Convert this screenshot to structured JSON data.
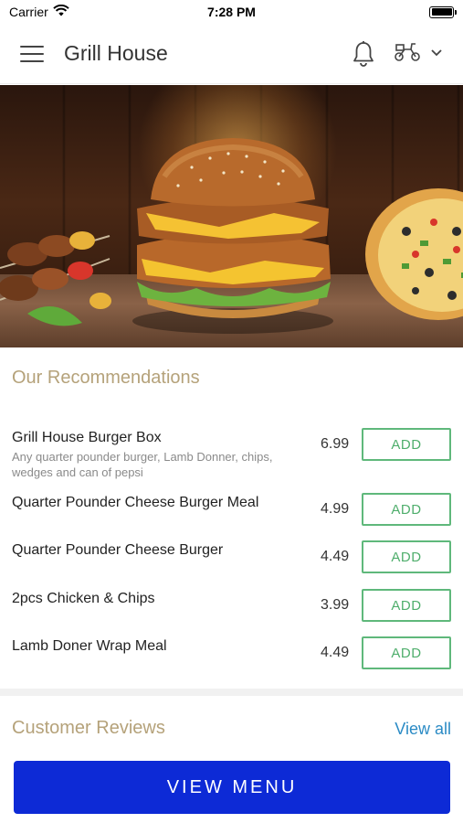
{
  "status_bar": {
    "carrier": "Carrier",
    "time": "7:28 PM",
    "icons": [
      "wifi-icon",
      "battery-icon"
    ]
  },
  "header": {
    "title": "Grill House",
    "icons": [
      "hamburger-menu-icon",
      "bell-icon",
      "scooter-delivery-icon",
      "chevron-down-icon"
    ]
  },
  "hero": {
    "description_icon": "food-banner-image"
  },
  "recommendations": {
    "title": "Our Recommendations",
    "items": [
      {
        "name": "Grill House Burger Box",
        "description": "Any quarter pounder burger, Lamb Donner, chips, wedges and can of pepsi",
        "price": "6.99",
        "button": "ADD"
      },
      {
        "name": "Quarter Pounder Cheese Burger Meal",
        "description": "",
        "price": "4.99",
        "button": "ADD"
      },
      {
        "name": "Quarter Pounder Cheese Burger",
        "description": "",
        "price": "4.49",
        "button": "ADD"
      },
      {
        "name": "2pcs Chicken & Chips",
        "description": "",
        "price": "3.99",
        "button": "ADD"
      },
      {
        "name": "Lamb Doner Wrap Meal",
        "description": "",
        "price": "4.49",
        "button": "ADD"
      }
    ]
  },
  "reviews": {
    "title": "Customer Reviews",
    "view_all": "View all"
  },
  "footer": {
    "button": "VIEW MENU"
  },
  "colors": {
    "accent_gold": "#b5a27a",
    "add_green": "#4fae6c",
    "link_blue": "#2b8bc5",
    "primary_button": "#0d2ad6"
  }
}
